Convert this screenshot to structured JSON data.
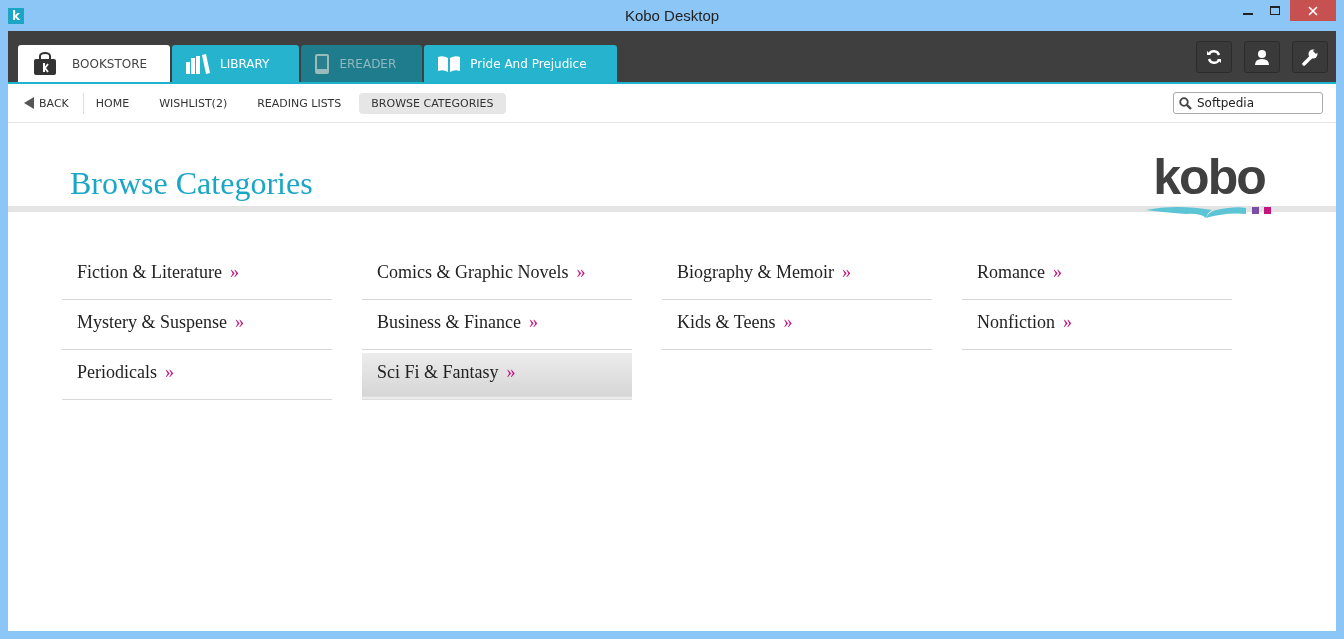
{
  "window": {
    "title": "Kobo Desktop",
    "app_icon": "k"
  },
  "tabs": [
    {
      "kind": "store",
      "label": "BOOKSTORE",
      "selected": true,
      "disabled": false
    },
    {
      "kind": "library",
      "label": "LIBRARY",
      "selected": false,
      "disabled": false
    },
    {
      "kind": "ereader",
      "label": "EREADER",
      "selected": false,
      "disabled": true
    },
    {
      "kind": "book",
      "label": "Pride And Prejudice",
      "selected": false,
      "disabled": false
    }
  ],
  "nav": {
    "back": "BACK",
    "items": [
      {
        "label": "HOME",
        "selected": false
      },
      {
        "label": "WISHLIST(2)",
        "selected": false
      },
      {
        "label": "READING LISTS",
        "selected": false
      },
      {
        "label": "BROWSE CATEGORIES",
        "selected": true
      }
    ]
  },
  "search": {
    "value": "Softpedia"
  },
  "page": {
    "title": "Browse Categories",
    "logo": "kobo"
  },
  "columns": [
    [
      {
        "label": "Fiction & Literature",
        "arrow": "»",
        "selected": false
      },
      {
        "label": "Mystery & Suspense",
        "arrow": "»",
        "selected": false
      },
      {
        "label": "Periodicals",
        "arrow": "»",
        "selected": false
      }
    ],
    [
      {
        "label": "Comics & Graphic Novels",
        "arrow": "»",
        "selected": false
      },
      {
        "label": "Business & Finance",
        "arrow": "»",
        "selected": false
      },
      {
        "label": "Sci Fi & Fantasy",
        "arrow": "»",
        "selected": true
      }
    ],
    [
      {
        "label": "Biography & Memoir",
        "arrow": "»",
        "selected": false
      },
      {
        "label": "Kids & Teens",
        "arrow": "»",
        "selected": false
      }
    ],
    [
      {
        "label": "Romance",
        "arrow": "»",
        "selected": false
      },
      {
        "label": "Nonfiction",
        "arrow": "»",
        "selected": false
      }
    ]
  ]
}
